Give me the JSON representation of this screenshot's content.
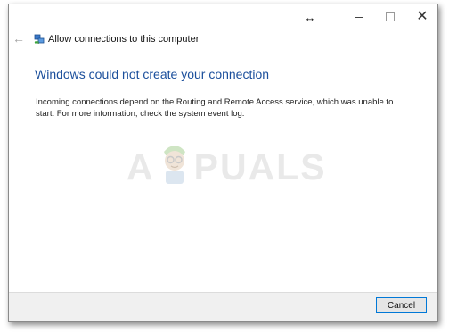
{
  "titlebar": {
    "resize_glyph": "↔",
    "close_glyph": "✕",
    "icons": [
      "resize-icon",
      "minimize-icon",
      "maximize-icon",
      "close-icon"
    ]
  },
  "header": {
    "back_glyph": "←",
    "app_icon": "network-connection-icon",
    "title": "Allow connections to this computer"
  },
  "main": {
    "heading": "Windows could not create your connection",
    "message": "Incoming connections depend on the Routing and Remote Access service, which was unable to start. For more information, check the system event log."
  },
  "watermark": {
    "text_left": "A",
    "text_right": "PUALS"
  },
  "footer": {
    "cancel_label": "Cancel"
  },
  "colors": {
    "heading": "#1b4f9c",
    "button_border": "#0078d7",
    "footer_bg": "#f0f0f0",
    "watermark": "#e9e9e9"
  }
}
